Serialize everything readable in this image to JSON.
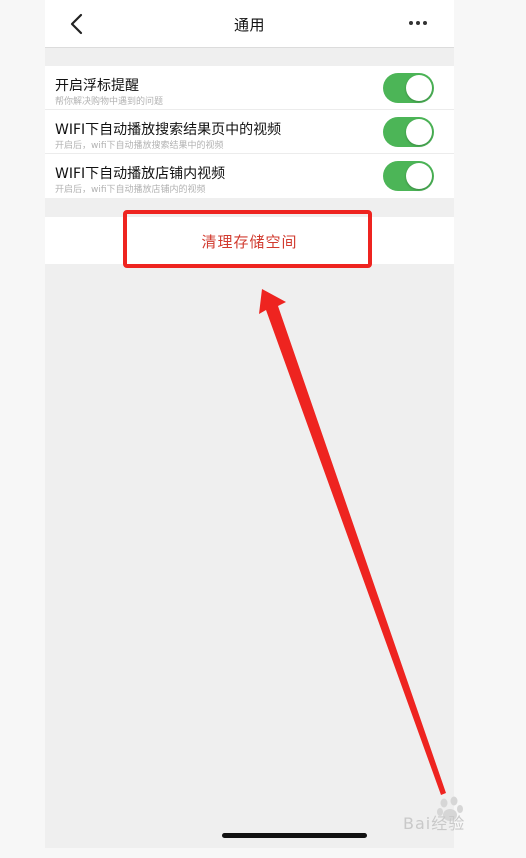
{
  "navbar": {
    "title": "通用",
    "back_icon": "chevron-left-icon",
    "more_icon": "more-horizontal-icon"
  },
  "settings": [
    {
      "title": "开启浮标提醒",
      "subtitle": "帮你解决购物中遇到的问题",
      "enabled": true
    },
    {
      "title": "WIFI下自动播放搜索结果页中的视频",
      "subtitle": "开启后，wifi下自动播放搜索结果中的视频",
      "enabled": true
    },
    {
      "title": "WIFI下自动播放店铺内视频",
      "subtitle": "开启后，wifi下自动播放店铺内的视频",
      "enabled": true
    }
  ],
  "clear_storage": {
    "label": "清理存储空间"
  },
  "colors": {
    "toggle_on": "#4cb557",
    "clear_text": "#d13b2f",
    "annotation_red": "#ee2420"
  },
  "watermark": {
    "text": "Bai经验"
  }
}
